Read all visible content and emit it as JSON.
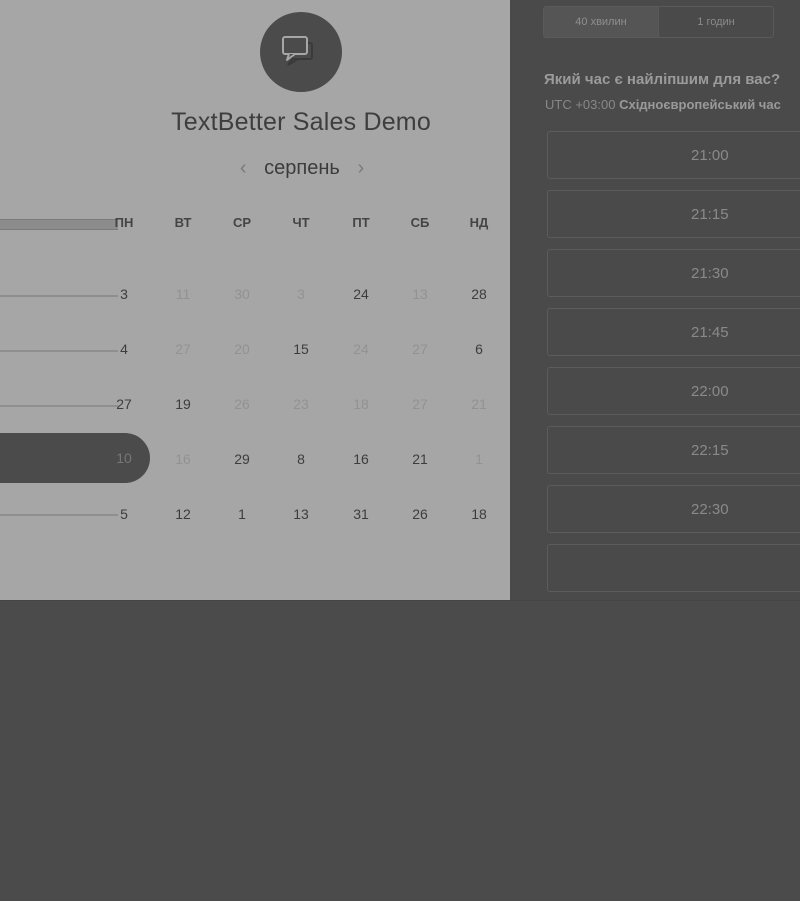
{
  "event": {
    "title": "TextBetter Sales Demo",
    "logo_icon": "chat-bubbles-icon"
  },
  "calendar": {
    "month": "серпень",
    "prev_icon": "chevron-left-icon",
    "next_icon": "chevron-right-icon",
    "weekdays": [
      "ПН",
      "ВТ",
      "СР",
      "ЧТ",
      "ПТ",
      "СБ",
      "НД"
    ],
    "weeks": [
      [
        "3",
        "11",
        "30",
        "3",
        "24",
        "13",
        "28"
      ],
      [
        "4",
        "27",
        "20",
        "15",
        "24",
        "27",
        "6"
      ],
      [
        "27",
        "19",
        "26",
        "23",
        "18",
        "27",
        "21"
      ],
      [
        "10",
        "16",
        "29",
        "8",
        "16",
        "21",
        "1"
      ],
      [
        "5",
        "12",
        "1",
        "13",
        "31",
        "26",
        "18"
      ]
    ],
    "selected_day": "10"
  },
  "duration": {
    "options": [
      "40 хвилин",
      "1 годин"
    ],
    "selected": "40 хвилин"
  },
  "time_picker": {
    "question": "Який час є найліпшим для вас?",
    "tz_prefix": "UTC +03:00",
    "tz_name": "Східноєвропейський час",
    "slots": [
      "21:00",
      "21:15",
      "21:30",
      "21:45",
      "22:00",
      "22:15",
      "22:30"
    ]
  },
  "colors": {
    "overlay_dark": "#4b4b4b",
    "calendar_bg": "#a6a6a6"
  }
}
